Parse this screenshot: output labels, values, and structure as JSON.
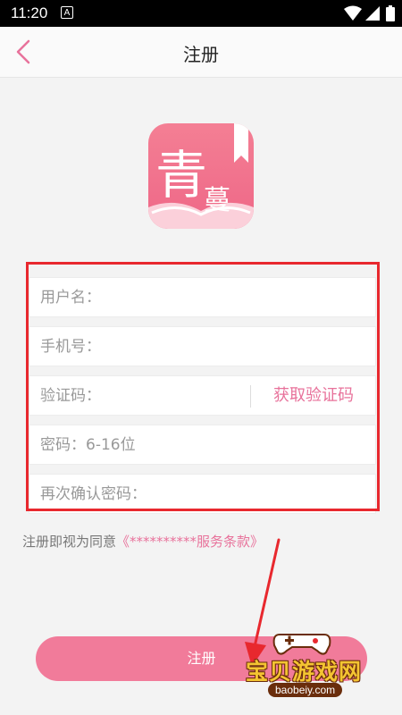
{
  "status_bar": {
    "time": "11:20",
    "notification_icon": "A"
  },
  "nav": {
    "title": "注册"
  },
  "logo": {
    "text_main": "青",
    "text_sub": "蔓"
  },
  "form": {
    "username_placeholder": "用户名：",
    "phone_placeholder": "手机号：",
    "code_placeholder": "验证码：",
    "get_code_label": "获取验证码",
    "password_placeholder": "密码：6-16位",
    "confirm_placeholder": "再次确认密码："
  },
  "agreement": {
    "prefix": "注册即视为同意",
    "link": "《**********服务条款》"
  },
  "register_button": "注册",
  "watermark": {
    "text": "宝贝游戏网",
    "url": "baobeiy.com"
  },
  "colors": {
    "accent": "#f17b9a",
    "link": "#e8729b",
    "frame": "#e8282e"
  }
}
